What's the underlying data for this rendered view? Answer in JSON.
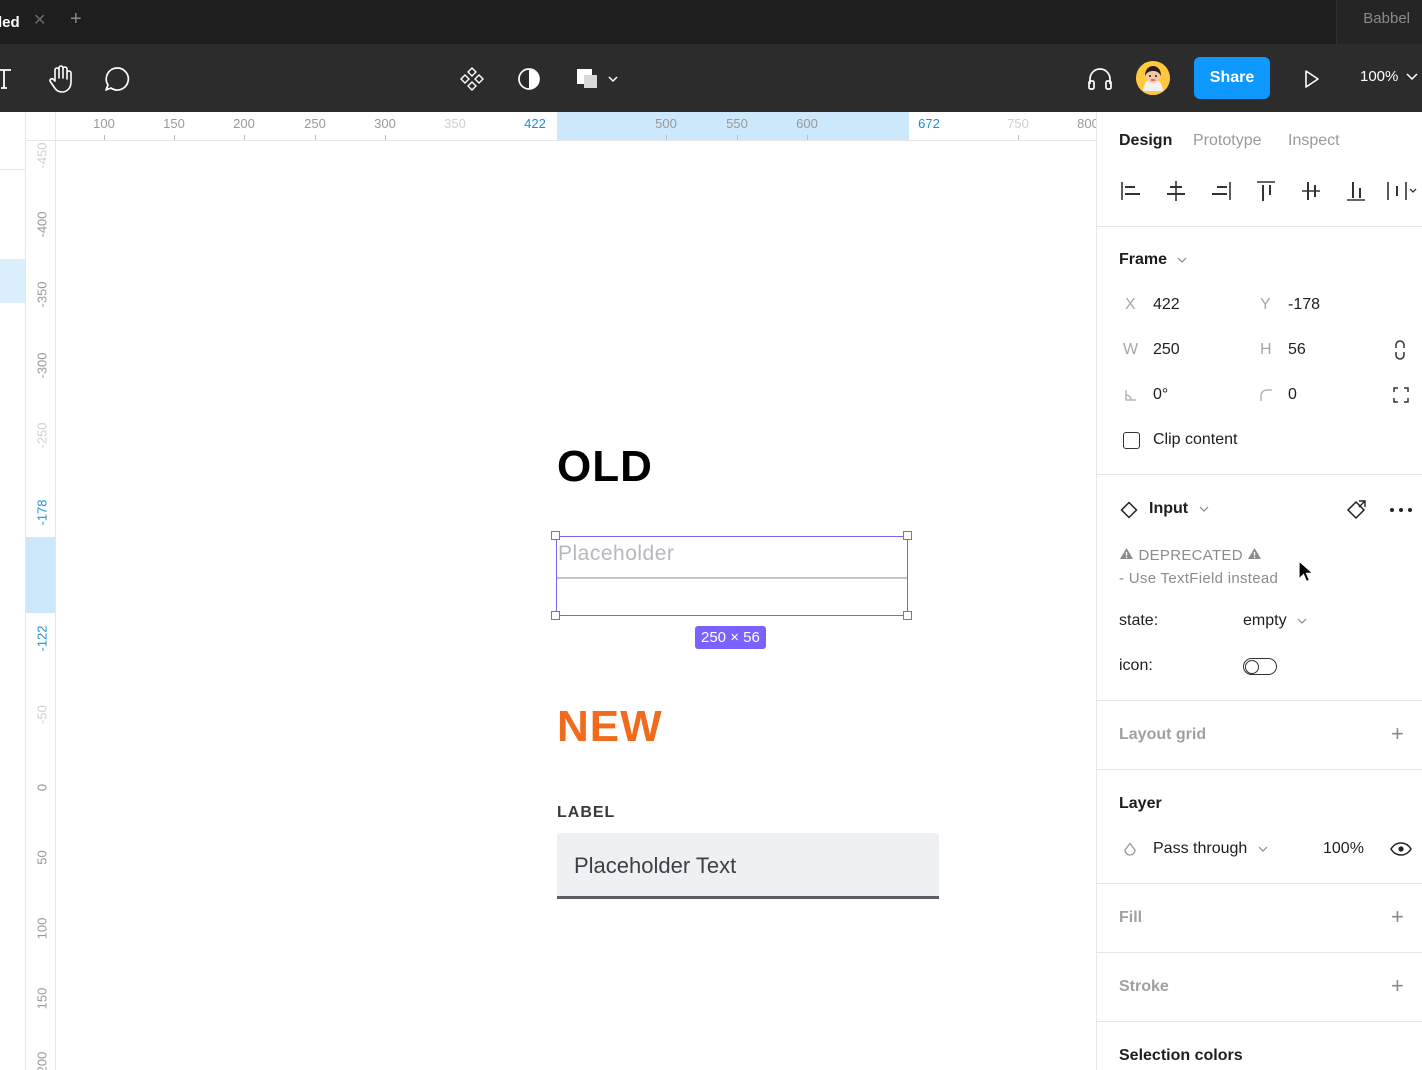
{
  "tabbar": {
    "tab_label": "led",
    "close_glyph": "✕",
    "add_glyph": "+",
    "right_label": "Babbel"
  },
  "toolbar": {
    "tools": [
      "text-tool-icon",
      "hand-tool-icon",
      "comment-tool-icon",
      "component-icon",
      "contrast-icon",
      "shapes-icon"
    ],
    "share_label": "Share",
    "zoom_label": "100%",
    "accent": "#0d99ff"
  },
  "rulers": {
    "top": [
      {
        "label": "100",
        "state": "normal"
      },
      {
        "label": "150",
        "state": "normal"
      },
      {
        "label": "200",
        "state": "normal"
      },
      {
        "label": "250",
        "state": "normal"
      },
      {
        "label": "300",
        "state": "normal"
      },
      {
        "label": "350",
        "state": "faint"
      },
      {
        "label": "422",
        "state": "sel"
      },
      {
        "label": "500",
        "state": "normal"
      },
      {
        "label": "550",
        "state": "normal"
      },
      {
        "label": "600",
        "state": "normal"
      },
      {
        "label": "672",
        "state": "sel"
      },
      {
        "label": "750",
        "state": "faint"
      },
      {
        "label": "800",
        "state": "normal"
      }
    ],
    "left": [
      {
        "label": "-450",
        "state": "faint"
      },
      {
        "label": "-400",
        "state": "normal"
      },
      {
        "label": "-350",
        "state": "normal"
      },
      {
        "label": "-300",
        "state": "normal"
      },
      {
        "label": "-250",
        "state": "faint"
      },
      {
        "label": "-178",
        "state": "sel"
      },
      {
        "label": "-122",
        "state": "sel"
      },
      {
        "label": "-50",
        "state": "faint"
      },
      {
        "label": "0",
        "state": "normal"
      },
      {
        "label": "50",
        "state": "normal"
      },
      {
        "label": "100",
        "state": "normal"
      },
      {
        "label": "150",
        "state": "normal"
      },
      {
        "label": "200",
        "state": "normal"
      }
    ]
  },
  "canvas": {
    "old_heading": "OLD",
    "old_placeholder": "Placeholder",
    "dimension_badge": "250 × 56",
    "new_heading": "NEW",
    "new_label": "LABEL",
    "new_placeholder": "Placeholder Text",
    "new_heading_color": "#f26a1b",
    "selection_color": "#7b61ff"
  },
  "panel": {
    "tabs": [
      "Design",
      "Prototype",
      "Inspect"
    ],
    "active_tab": "Design",
    "frame_title": "Frame",
    "x_key": "X",
    "x_val": "422",
    "y_key": "Y",
    "y_val": "-178",
    "w_key": "W",
    "w_val": "250",
    "h_key": "H",
    "h_val": "56",
    "rotation_val": "0°",
    "radius_val": "0",
    "clip_content": "Clip content",
    "component_name": "Input",
    "deprecated_line1": "DEPRECATED",
    "deprecated_line2": "- Use TextField instead",
    "state_key": "state:",
    "state_val": "empty",
    "icon_key": "icon:",
    "layout_grid": "Layout grid",
    "layer_title": "Layer",
    "blend_mode": "Pass through",
    "opacity": "100%",
    "fill_title": "Fill",
    "stroke_title": "Stroke",
    "selection_colors": "Selection colors"
  }
}
